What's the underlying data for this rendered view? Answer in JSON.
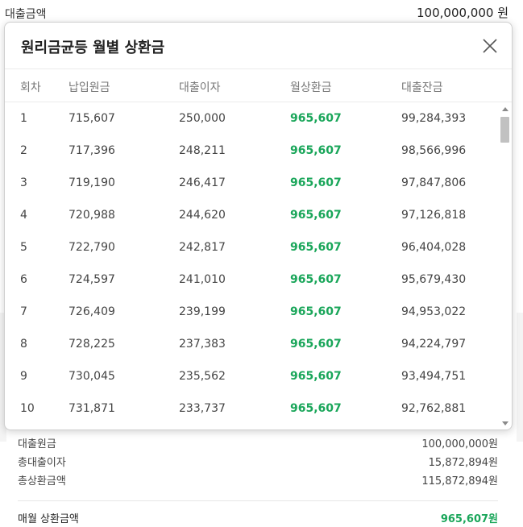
{
  "background": {
    "loan_amount_label": "대출금액",
    "loan_amount_value": "100,000,000  원"
  },
  "modal": {
    "title": "원리금균등 월별 상환금",
    "columns": [
      "회차",
      "납입원금",
      "대출이자",
      "월상환금",
      "대출잔금"
    ],
    "rows": [
      [
        "1",
        "715,607",
        "250,000",
        "965,607",
        "99,284,393"
      ],
      [
        "2",
        "717,396",
        "248,211",
        "965,607",
        "98,566,996"
      ],
      [
        "3",
        "719,190",
        "246,417",
        "965,607",
        "97,847,806"
      ],
      [
        "4",
        "720,988",
        "244,620",
        "965,607",
        "97,126,818"
      ],
      [
        "5",
        "722,790",
        "242,817",
        "965,607",
        "96,404,028"
      ],
      [
        "6",
        "724,597",
        "241,010",
        "965,607",
        "95,679,430"
      ],
      [
        "7",
        "726,409",
        "239,199",
        "965,607",
        "94,953,022"
      ],
      [
        "8",
        "728,225",
        "237,383",
        "965,607",
        "94,224,797"
      ],
      [
        "9",
        "730,045",
        "235,562",
        "965,607",
        "93,494,751"
      ],
      [
        "10",
        "731,871",
        "233,737",
        "965,607",
        "92,762,881"
      ]
    ],
    "close_icon": "close-icon"
  },
  "summary": {
    "principal_label": "대출원금",
    "principal_value": "100,000,000원",
    "interest_label": "총대출이자",
    "interest_value": "15,872,894원",
    "total_label": "총상환금액",
    "total_value": "115,872,894원",
    "monthly_label": "매월 상환금액",
    "monthly_value": "965,607원"
  },
  "colors": {
    "accent_green": "#1aa65a"
  }
}
